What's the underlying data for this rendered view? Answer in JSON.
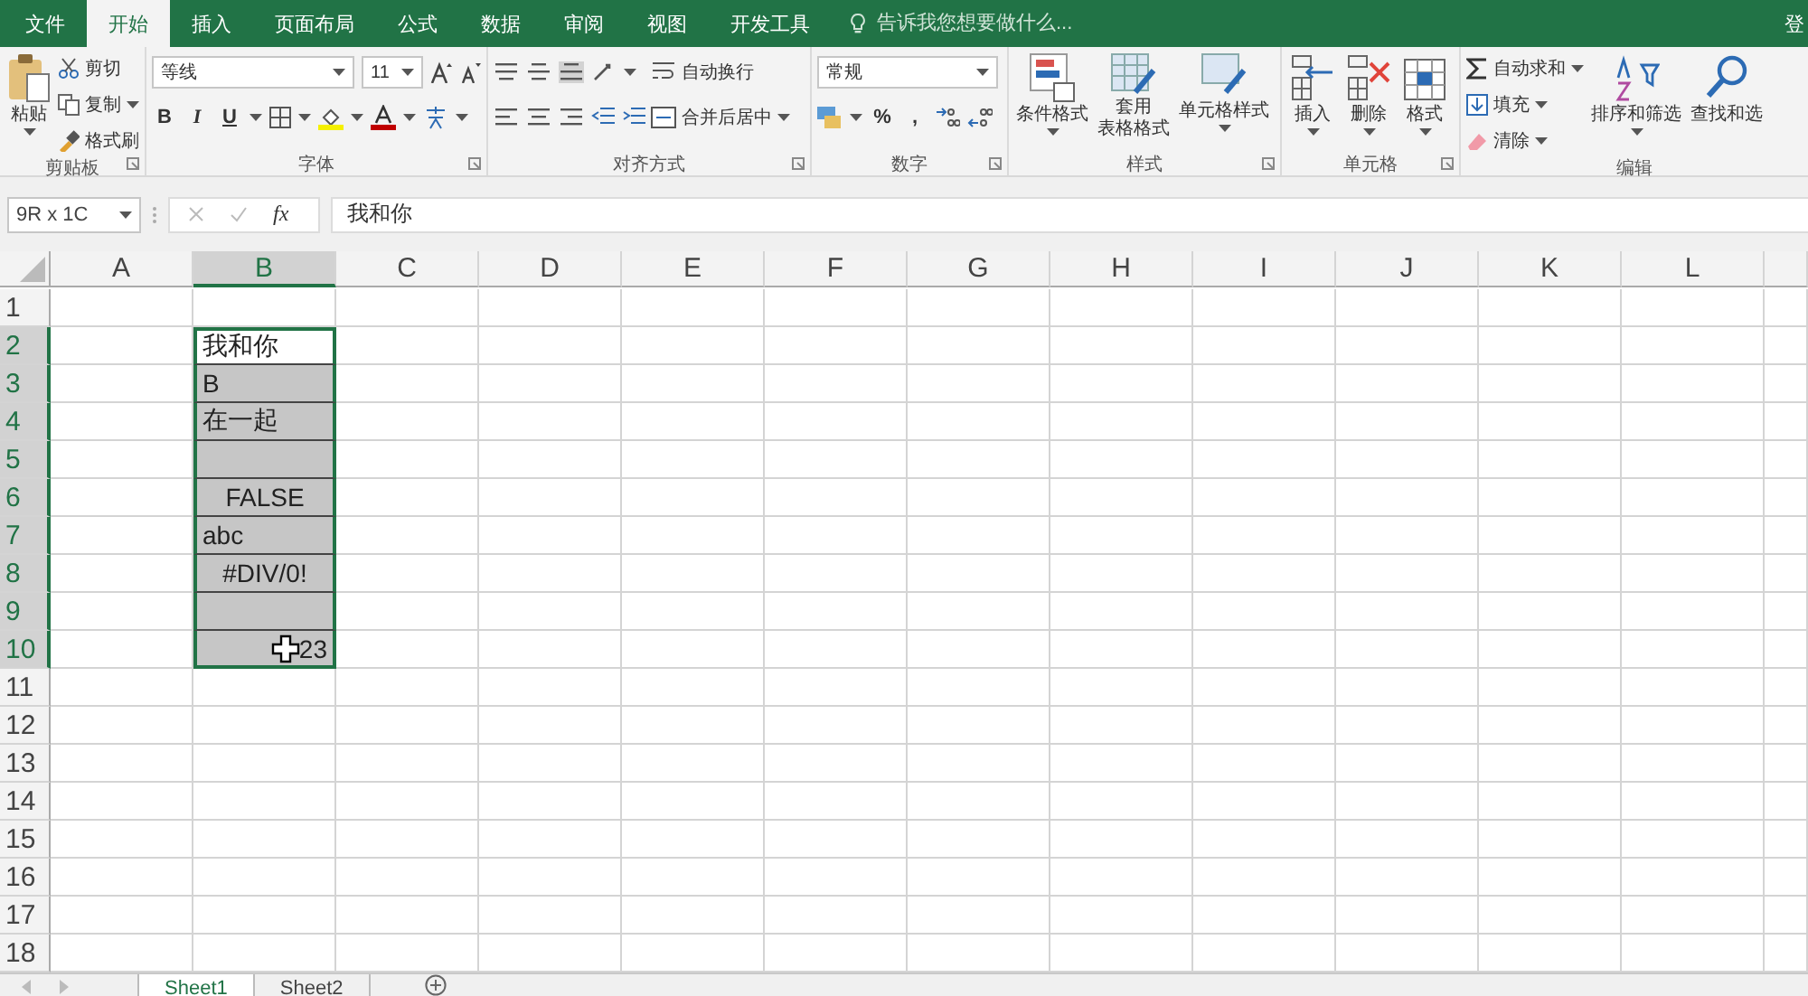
{
  "tabs": [
    {
      "label": "文件",
      "selected": false
    },
    {
      "label": "开始",
      "selected": true
    },
    {
      "label": "插入",
      "selected": false
    },
    {
      "label": "页面布局",
      "selected": false
    },
    {
      "label": "公式",
      "selected": false
    },
    {
      "label": "数据",
      "selected": false
    },
    {
      "label": "审阅",
      "selected": false
    },
    {
      "label": "视图",
      "selected": false
    },
    {
      "label": "开发工具",
      "selected": false
    }
  ],
  "tell_me": {
    "placeholder": "告诉我您想要做什么..."
  },
  "account": "登",
  "ribbon": {
    "clipboard": {
      "paste": "粘贴",
      "cut": "剪切",
      "copy": "复制",
      "format_painter": "格式刷",
      "title": "剪贴板"
    },
    "font": {
      "font_name": "等线",
      "font_size": "11",
      "bold": "B",
      "italic": "I",
      "underline": "U",
      "title": "字体"
    },
    "alignment": {
      "wrap_text": "自动换行",
      "merge_center": "合并后居中",
      "title": "对齐方式"
    },
    "number": {
      "format": "常规",
      "percent": "%",
      "comma": ",",
      "title": "数字"
    },
    "styles": {
      "conditional": "条件格式",
      "table_format": [
        "套用",
        "表格格式"
      ],
      "cell_style": "单元格样式",
      "title": "样式"
    },
    "cells": {
      "insert": "插入",
      "delete": "删除",
      "format": "格式",
      "title": "单元格"
    },
    "editing": {
      "autosum": "自动求和",
      "fill": "填充",
      "clear": "清除",
      "sort_filter": "排序和筛选",
      "find_select": "查找和选",
      "title": "编辑"
    }
  },
  "name_box": {
    "value": "9R x 1C"
  },
  "formula_bar": {
    "function_label": "fx",
    "value": "我和你"
  },
  "columns": [
    {
      "label": "A",
      "selected": false
    },
    {
      "label": "B",
      "selected": true
    },
    {
      "label": "C",
      "selected": false
    },
    {
      "label": "D",
      "selected": false
    },
    {
      "label": "E",
      "selected": false
    },
    {
      "label": "F",
      "selected": false
    },
    {
      "label": "G",
      "selected": false
    },
    {
      "label": "H",
      "selected": false
    },
    {
      "label": "I",
      "selected": false
    },
    {
      "label": "J",
      "selected": false
    },
    {
      "label": "K",
      "selected": false
    },
    {
      "label": "L",
      "selected": false
    }
  ],
  "rows": [
    {
      "label": "1",
      "selected": false,
      "cell_b": {
        "selected": false,
        "active": false
      }
    },
    {
      "label": "2",
      "selected": true,
      "cell_b": {
        "value": "我和你",
        "kind": "text",
        "selected": false,
        "active": true
      }
    },
    {
      "label": "3",
      "selected": true,
      "cell_b": {
        "value": "B",
        "kind": "text",
        "selected": true,
        "active": false
      }
    },
    {
      "label": "4",
      "selected": true,
      "cell_b": {
        "value": "在一起",
        "kind": "text",
        "selected": true,
        "active": false
      }
    },
    {
      "label": "5",
      "selected": true,
      "cell_b": {
        "selected": true,
        "active": false
      }
    },
    {
      "label": "6",
      "selected": true,
      "cell_b": {
        "value": "FALSE",
        "kind": "boolean",
        "selected": true,
        "active": false
      }
    },
    {
      "label": "7",
      "selected": true,
      "cell_b": {
        "value": "abc",
        "kind": "text",
        "selected": true,
        "active": false
      }
    },
    {
      "label": "8",
      "selected": true,
      "cell_b": {
        "value": "#DIV/0!",
        "kind": "error",
        "selected": true,
        "active": false
      }
    },
    {
      "label": "9",
      "selected": true,
      "cell_b": {
        "selected": true,
        "active": false
      }
    },
    {
      "label": "10",
      "selected": true,
      "cell_b": {
        "value": "23",
        "kind": "number",
        "selected": true,
        "active": false
      }
    },
    {
      "label": "11",
      "selected": false,
      "cell_b": {
        "selected": false,
        "active": false
      }
    },
    {
      "label": "12",
      "selected": false,
      "cell_b": {
        "selected": false,
        "active": false
      }
    },
    {
      "label": "13",
      "selected": false,
      "cell_b": {
        "selected": false,
        "active": false
      }
    },
    {
      "label": "14",
      "selected": false,
      "cell_b": {
        "selected": false,
        "active": false
      }
    },
    {
      "label": "15",
      "selected": false,
      "cell_b": {
        "selected": false,
        "active": false
      }
    },
    {
      "label": "16",
      "selected": false,
      "cell_b": {
        "selected": false,
        "active": false
      }
    },
    {
      "label": "17",
      "selected": false,
      "cell_b": {
        "selected": false,
        "active": false
      }
    },
    {
      "label": "18",
      "selected": false,
      "cell_b": {
        "selected": false,
        "active": false
      }
    }
  ],
  "sheets": [
    {
      "label": "Sheet1",
      "selected": true
    },
    {
      "label": "Sheet2",
      "selected": false
    }
  ]
}
